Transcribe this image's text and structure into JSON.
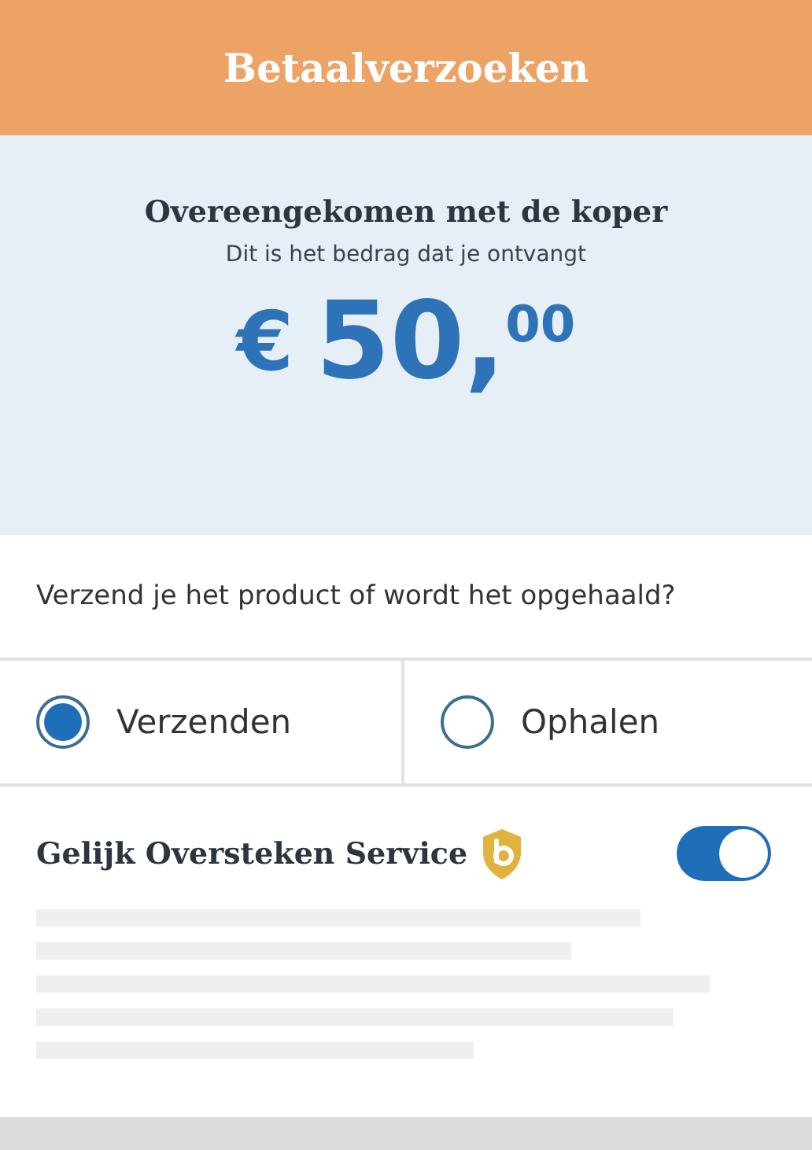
{
  "header": {
    "title": "Betaalverzoeken"
  },
  "summary": {
    "title": "Overeengekomen met de koper",
    "subtitle": "Dit is het bedrag dat je ontvangt",
    "amount": {
      "currency": "€",
      "whole": "50",
      "separator": ",",
      "cents": "00"
    }
  },
  "shipping": {
    "question": "Verzend je het product of wordt het opgehaald?",
    "options": [
      {
        "label": "Verzenden",
        "selected": true
      },
      {
        "label": "Ophalen",
        "selected": false
      }
    ]
  },
  "service": {
    "title": "Gelijk Oversteken Service",
    "on": true
  }
}
